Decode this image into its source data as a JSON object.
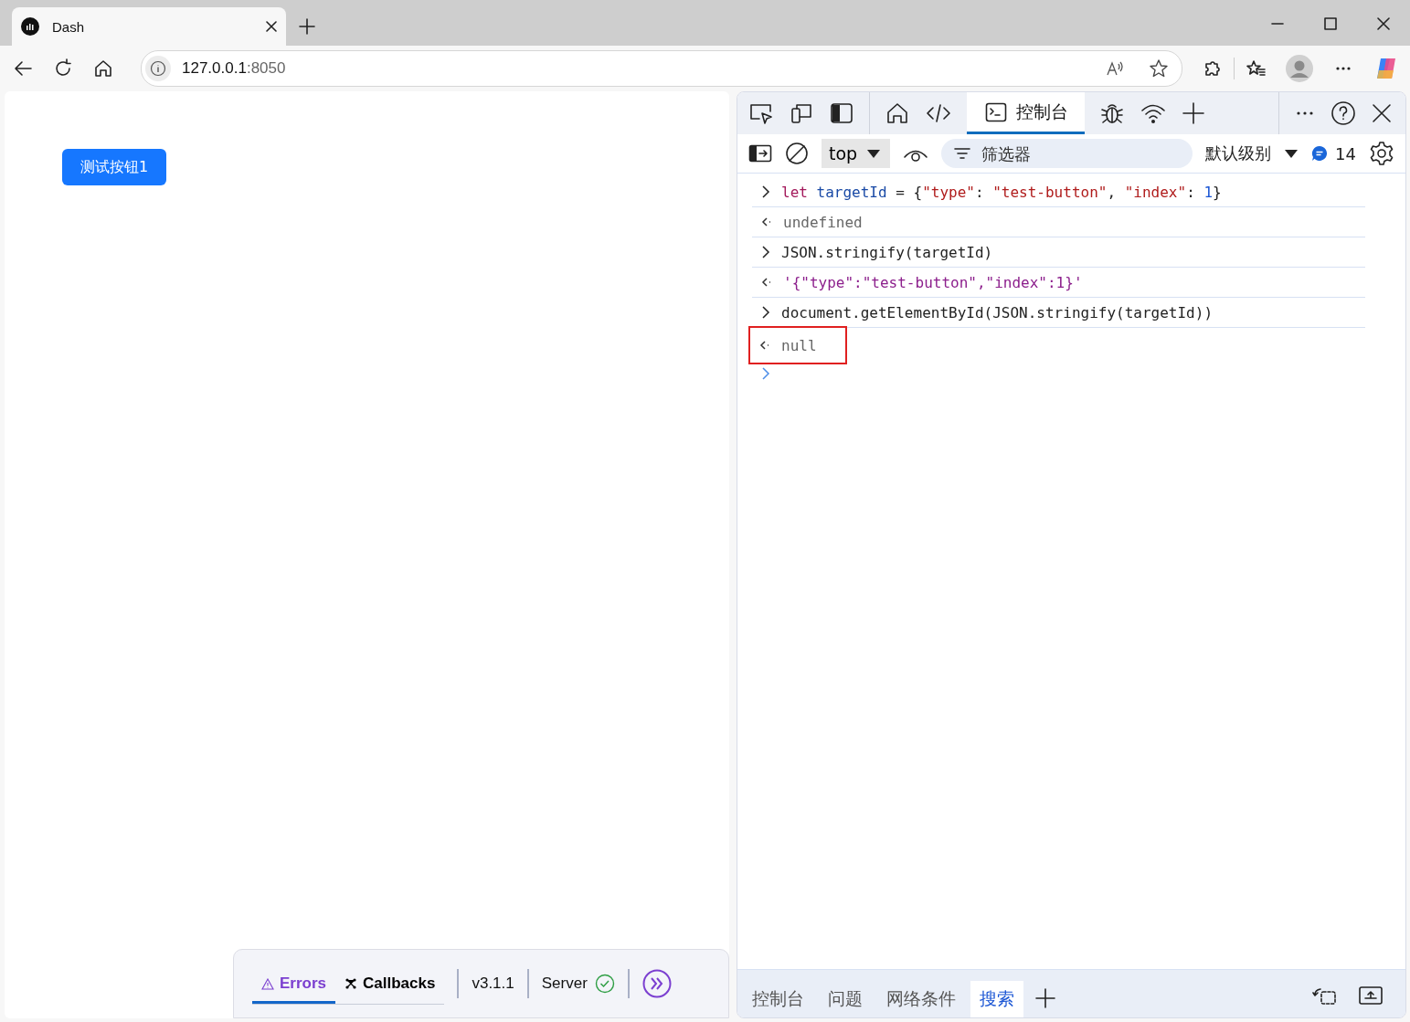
{
  "browser": {
    "tabs": [
      {
        "title": "Dash",
        "selected": true
      }
    ],
    "address": {
      "host": "127.0.0.1",
      "port": ":8050"
    }
  },
  "page": {
    "button": "测试按钮1"
  },
  "dash_footer": {
    "tabs": [
      {
        "label": "Errors",
        "selected": true
      },
      {
        "label": "Callbacks",
        "selected": false
      }
    ],
    "version": "v3.1.1",
    "server": "Server"
  },
  "devtools": {
    "tabs": [
      {
        "label": "控制台",
        "selected": true
      }
    ],
    "toolbar": {
      "context": "top",
      "filter_placeholder": "筛选器",
      "level": "默认级别",
      "message_count": "14"
    },
    "console": [
      {
        "kind": "input",
        "highlighted": false,
        "tokens": [
          {
            "kind": "keyword",
            "text": "let "
          },
          {
            "kind": "variable",
            "text": "targetId"
          },
          {
            "kind": "plain",
            "text": " = {"
          },
          {
            "kind": "string",
            "text": "\"type\""
          },
          {
            "kind": "plain",
            "text": ": "
          },
          {
            "kind": "string",
            "text": "\"test-button\""
          },
          {
            "kind": "plain",
            "text": ", "
          },
          {
            "kind": "string",
            "text": "\"index\""
          },
          {
            "kind": "plain",
            "text": ": "
          },
          {
            "kind": "number",
            "text": "1"
          },
          {
            "kind": "plain",
            "text": "}"
          }
        ]
      },
      {
        "kind": "output",
        "highlighted": false,
        "tokens": [
          {
            "kind": "muted",
            "text": "undefined"
          }
        ]
      },
      {
        "kind": "input",
        "highlighted": false,
        "tokens": [
          {
            "kind": "plain",
            "text": "JSON.stringify(targetId)"
          }
        ]
      },
      {
        "kind": "output",
        "highlighted": false,
        "tokens": [
          {
            "kind": "result-string",
            "text": "'{\"type\":\"test-button\",\"index\":1}'"
          }
        ]
      },
      {
        "kind": "input",
        "highlighted": false,
        "tokens": [
          {
            "kind": "plain",
            "text": "document.getElementById(JSON.stringify(targetId))"
          }
        ]
      },
      {
        "kind": "output",
        "highlighted": true,
        "tokens": [
          {
            "kind": "muted",
            "text": "null"
          }
        ]
      }
    ],
    "drawer_tabs": [
      {
        "label": "控制台",
        "selected": false
      },
      {
        "label": "问题",
        "selected": false
      },
      {
        "label": "网络条件",
        "selected": false
      },
      {
        "label": "搜索",
        "selected": true
      }
    ]
  }
}
